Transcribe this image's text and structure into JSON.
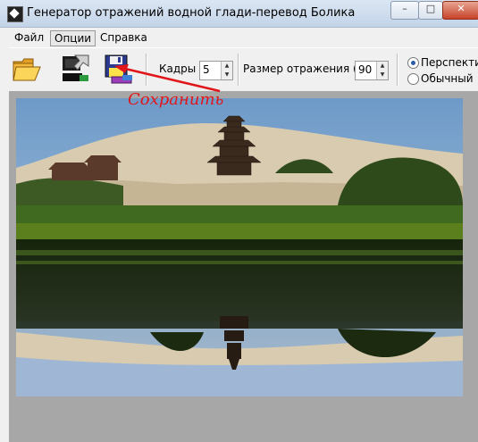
{
  "window": {
    "title": "Генератор отражений водной глади-перевод Болика"
  },
  "window_controls": {
    "minimize": "–",
    "maximize": "□",
    "close": "✕"
  },
  "menu": {
    "file": "Файл",
    "options": "Опции",
    "help": "Справка"
  },
  "toolbar": {
    "frames_label": "Кадры :",
    "frames_value": "5",
    "reflection_label": "Размер отражения (%) :",
    "reflection_value": "90",
    "mode_perspective": "Перспектива",
    "mode_normal": "Обычный",
    "selected_mode": "Перспектива"
  },
  "annotation": {
    "text": "Сохранить",
    "color": "#e0161a"
  },
  "icons": {
    "open": "folder-open-icon",
    "generate": "generate-icon",
    "save": "floppy-disk-icon"
  }
}
